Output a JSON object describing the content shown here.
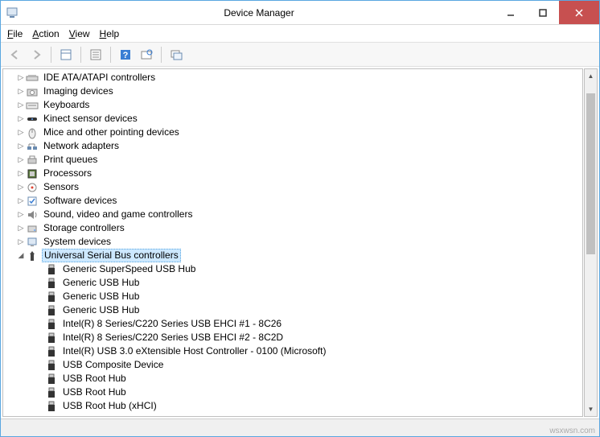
{
  "window": {
    "title": "Device Manager"
  },
  "menubar": {
    "file": "File",
    "action": "Action",
    "view": "View",
    "help": "Help"
  },
  "toolbar": {
    "back": "Back",
    "forward": "Forward",
    "properties": "Properties",
    "update": "Update driver",
    "help": "Help",
    "scan": "Scan for hardware changes",
    "show": "Show hidden devices"
  },
  "categories": [
    {
      "label": "IDE ATA/ATAPI controllers",
      "icon": "ide-icon",
      "expanded": false
    },
    {
      "label": "Imaging devices",
      "icon": "camera-icon",
      "expanded": false
    },
    {
      "label": "Keyboards",
      "icon": "keyboard-icon",
      "expanded": false
    },
    {
      "label": "Kinect sensor devices",
      "icon": "kinect-icon",
      "expanded": false
    },
    {
      "label": "Mice and other pointing devices",
      "icon": "mouse-icon",
      "expanded": false
    },
    {
      "label": "Network adapters",
      "icon": "network-icon",
      "expanded": false
    },
    {
      "label": "Print queues",
      "icon": "printer-icon",
      "expanded": false
    },
    {
      "label": "Processors",
      "icon": "cpu-icon",
      "expanded": false
    },
    {
      "label": "Sensors",
      "icon": "sensor-icon",
      "expanded": false
    },
    {
      "label": "Software devices",
      "icon": "software-icon",
      "expanded": false
    },
    {
      "label": "Sound, video and game controllers",
      "icon": "sound-icon",
      "expanded": false
    },
    {
      "label": "Storage controllers",
      "icon": "storage-icon",
      "expanded": false
    },
    {
      "label": "System devices",
      "icon": "system-icon",
      "expanded": false
    },
    {
      "label": "Universal Serial Bus controllers",
      "icon": "usb-icon",
      "expanded": true,
      "selected": true,
      "children": [
        {
          "label": "Generic SuperSpeed USB Hub",
          "icon": "usb-plug-icon"
        },
        {
          "label": "Generic USB Hub",
          "icon": "usb-plug-icon"
        },
        {
          "label": "Generic USB Hub",
          "icon": "usb-plug-icon"
        },
        {
          "label": "Generic USB Hub",
          "icon": "usb-plug-icon"
        },
        {
          "label": "Intel(R) 8 Series/C220 Series USB EHCI #1 - 8C26",
          "icon": "usb-plug-icon"
        },
        {
          "label": "Intel(R) 8 Series/C220 Series USB EHCI #2 - 8C2D",
          "icon": "usb-plug-icon"
        },
        {
          "label": "Intel(R) USB 3.0 eXtensible Host Controller - 0100 (Microsoft)",
          "icon": "usb-plug-icon"
        },
        {
          "label": "USB Composite Device",
          "icon": "usb-plug-icon"
        },
        {
          "label": "USB Root Hub",
          "icon": "usb-plug-icon"
        },
        {
          "label": "USB Root Hub",
          "icon": "usb-plug-icon"
        },
        {
          "label": "USB Root Hub (xHCI)",
          "icon": "usb-plug-icon"
        }
      ]
    }
  ],
  "watermark": "wsxwsn.com"
}
